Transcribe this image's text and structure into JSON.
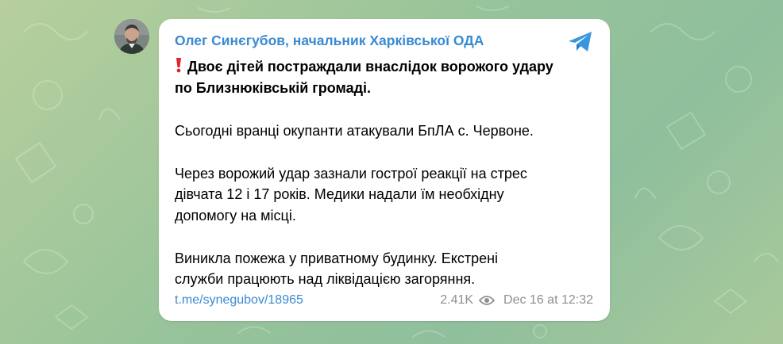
{
  "post": {
    "sender": "Олег Синєгубов, начальник Харківської ОДА",
    "headline_line1": "Двоє дітей постраждали внаслідок ворожого удару",
    "headline_line2": "по Близнюківській громаді.",
    "para1": "Сьогодні вранці окупанти атакували БпЛА с. Червоне.",
    "para2_line1": "Через ворожий удар зазнали гострої реакції на стрес",
    "para2_line2": "дівчата 12 і 17 років. Медики надали їм необхідну",
    "para2_line3": "допомогу на місці.",
    "para3_line1": "Виникла пожежа у приватному будинку. Екстрені",
    "para3_line2": "служби працюють над ліквідацією загоряння.",
    "link": "t.me/synegubov/18965",
    "views": "2.41K",
    "date": "Dec 16 at 12:32"
  },
  "icons": {
    "share": "telegram-plane-icon",
    "views": "eye-icon",
    "alert": "red-exclamation-icon"
  },
  "colors": {
    "accent": "#3a8ad1",
    "exclamation": "#e0252c",
    "meta": "#8f8f8f",
    "bubble": "#ffffff"
  }
}
